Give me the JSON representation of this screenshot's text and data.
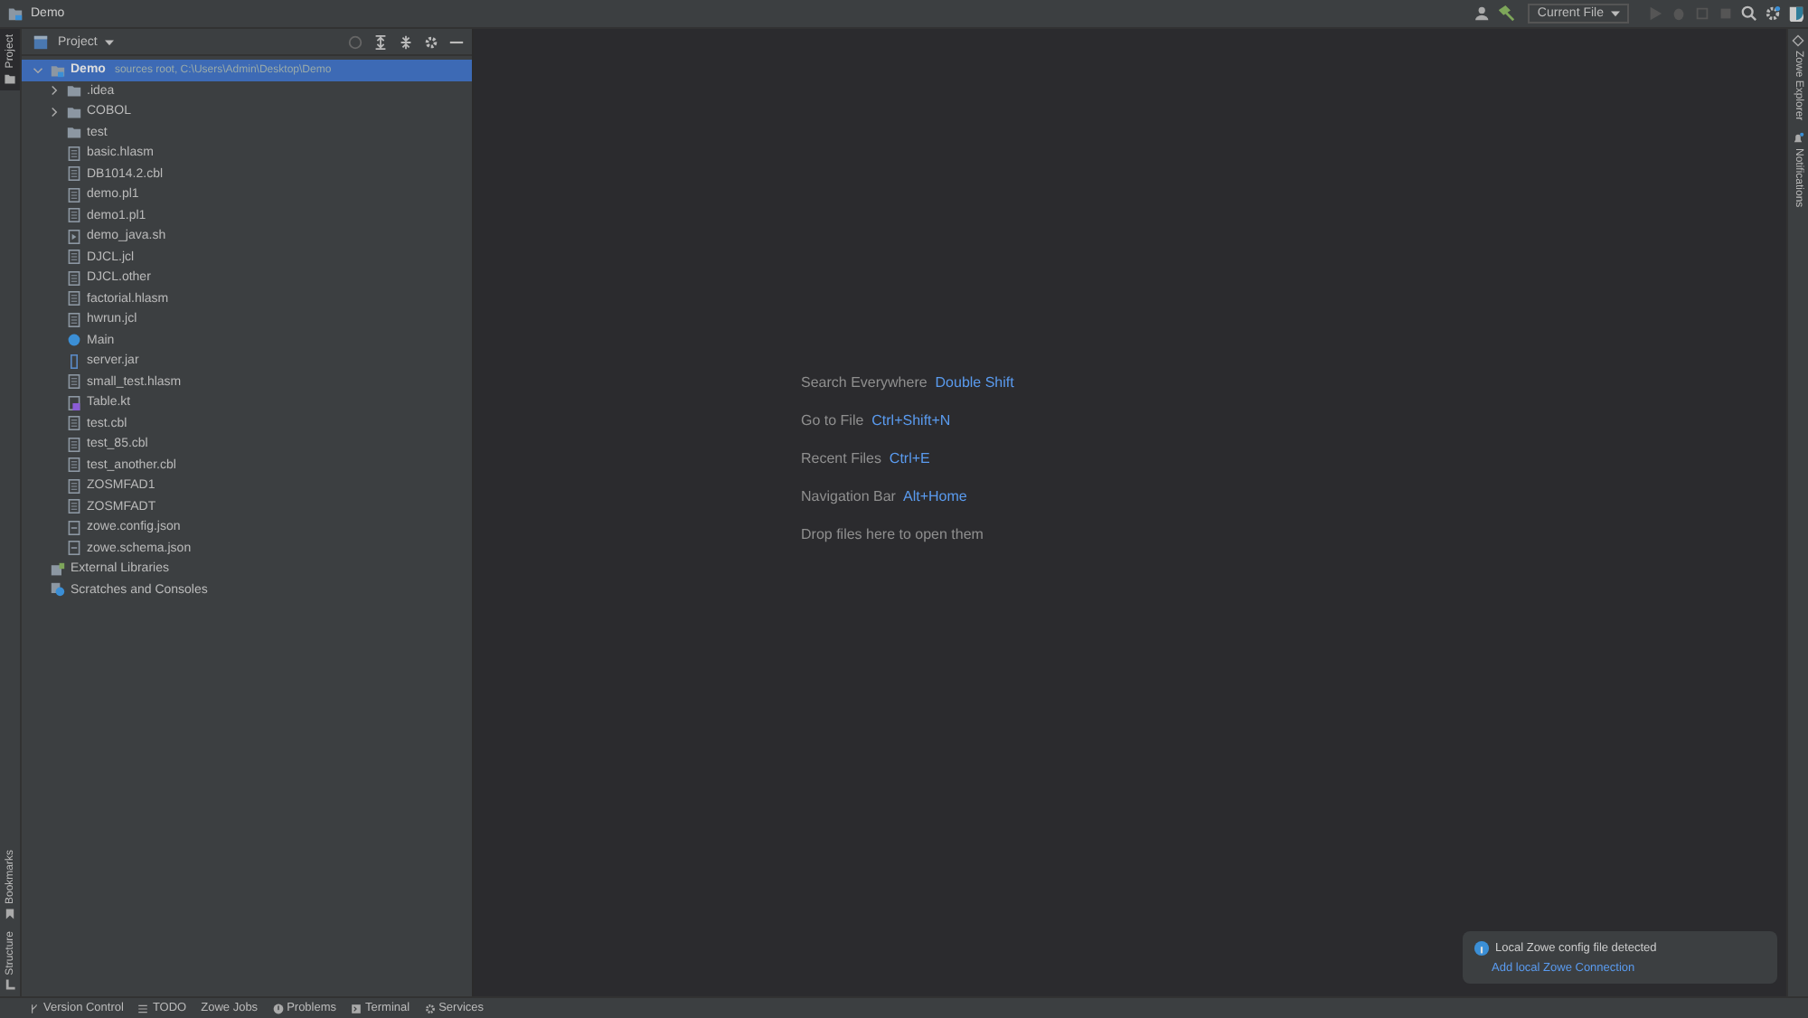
{
  "window": {
    "title": "Demo"
  },
  "toolbar": {
    "run_config": "Current File"
  },
  "left_stripe": {
    "top": [
      {
        "label": "Project",
        "selected": true
      }
    ],
    "bottom": [
      {
        "label": "Bookmarks",
        "kind": "bookmark"
      },
      {
        "label": "Structure",
        "kind": "structure"
      }
    ]
  },
  "right_stripe": [
    {
      "label": "Zowe Explorer",
      "kind": "zowe"
    },
    {
      "label": "Notifications",
      "kind": "bell"
    }
  ],
  "project_panel": {
    "title": "Project",
    "tree": [
      {
        "label": "Demo",
        "hint": "sources root,  C:\\Users\\Admin\\Desktop\\Demo",
        "kind": "module",
        "expanded": true,
        "selected": true,
        "children": [
          {
            "label": ".idea",
            "kind": "folder",
            "expanded": false,
            "selected": false
          },
          {
            "label": "COBOL",
            "kind": "folder",
            "expanded": false,
            "selected": false
          },
          {
            "label": "test",
            "kind": "folder",
            "selected": false
          },
          {
            "label": "basic.hlasm",
            "kind": "file",
            "selected": false
          },
          {
            "label": "DB1014.2.cbl",
            "kind": "file",
            "selected": false
          },
          {
            "label": "demo.pl1",
            "kind": "file",
            "selected": false
          },
          {
            "label": "demo1.pl1",
            "kind": "file",
            "selected": false
          },
          {
            "label": "demo_java.sh",
            "kind": "script",
            "selected": false
          },
          {
            "label": "DJCL.jcl",
            "kind": "file",
            "selected": false
          },
          {
            "label": "DJCL.other",
            "kind": "file",
            "selected": false
          },
          {
            "label": "factorial.hlasm",
            "kind": "file",
            "selected": false
          },
          {
            "label": "hwrun.jcl",
            "kind": "file",
            "selected": false
          },
          {
            "label": "Main",
            "kind": "class",
            "selected": false
          },
          {
            "label": "server.jar",
            "kind": "jar",
            "selected": false
          },
          {
            "label": "small_test.hlasm",
            "kind": "file",
            "selected": false
          },
          {
            "label": "Table.kt",
            "kind": "kotlin",
            "selected": false
          },
          {
            "label": "test.cbl",
            "kind": "file",
            "selected": false
          },
          {
            "label": "test_85.cbl",
            "kind": "file",
            "selected": false
          },
          {
            "label": "test_another.cbl",
            "kind": "file",
            "selected": false
          },
          {
            "label": "ZOSMFAD1",
            "kind": "file",
            "selected": false
          },
          {
            "label": "ZOSMFADT",
            "kind": "file",
            "selected": false
          },
          {
            "label": "zowe.config.json",
            "kind": "json",
            "selected": false
          },
          {
            "label": "zowe.schema.json",
            "kind": "json",
            "selected": false
          }
        ]
      },
      {
        "label": "External Libraries",
        "kind": "library",
        "selected": false
      },
      {
        "label": "Scratches and Consoles",
        "kind": "scratch",
        "selected": false
      }
    ]
  },
  "editor_hints": [
    {
      "label": "Search Everywhere",
      "shortcut": "Double Shift"
    },
    {
      "label": "Go to File",
      "shortcut": "Ctrl+Shift+N"
    },
    {
      "label": "Recent Files",
      "shortcut": "Ctrl+E"
    },
    {
      "label": "Navigation Bar",
      "shortcut": "Alt+Home"
    },
    {
      "label": "Drop files here to open them"
    }
  ],
  "notification": {
    "message": "Local Zowe config file detected",
    "link": "Add local Zowe Connection"
  },
  "bottom_bar": [
    {
      "label": "Version Control",
      "kind": "branch"
    },
    {
      "label": "TODO",
      "kind": "list"
    },
    {
      "label": "Zowe Jobs",
      "kind": "plain"
    },
    {
      "label": "Problems",
      "kind": "info"
    },
    {
      "label": "Terminal",
      "kind": "terminal"
    },
    {
      "label": "Services",
      "kind": "gear"
    }
  ]
}
